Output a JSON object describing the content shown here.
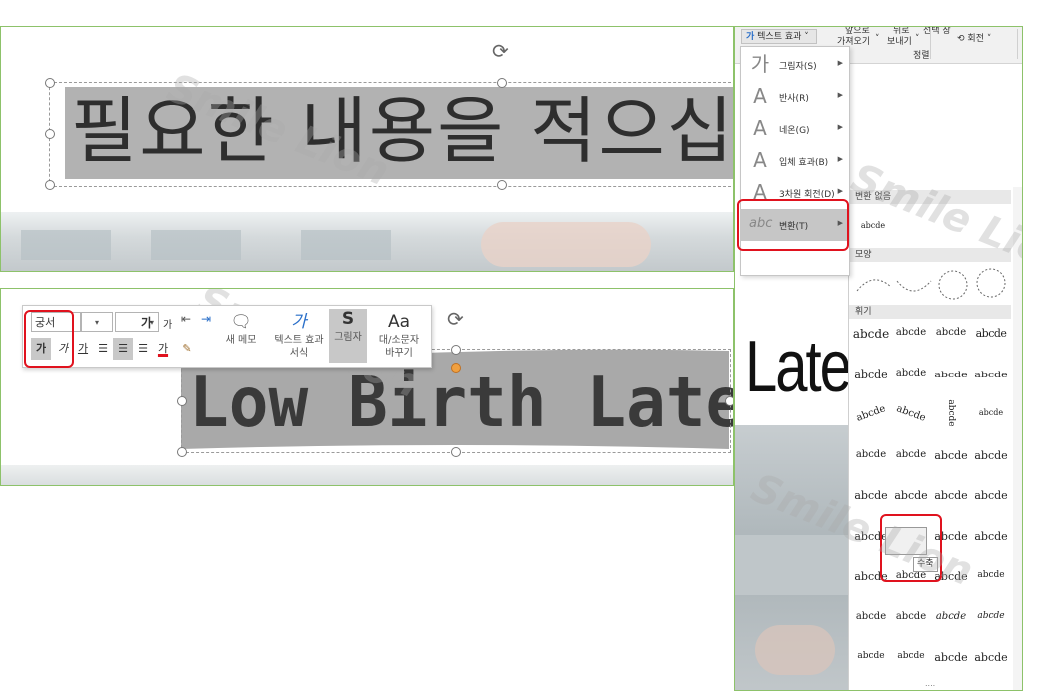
{
  "panel1": {
    "text": "필요한 내용을 적으십"
  },
  "panel2": {
    "text": "Low Birth Late",
    "toolbar": {
      "font_name": "궁서",
      "font_size": "",
      "grow_font_label": "가",
      "shrink_font_label": "가",
      "bold_label": "가",
      "italic_label": "가",
      "underline_label": "가",
      "font_color_label": "가",
      "new_memo_label": "새 메모",
      "text_effect_format_label": "텍스트 효과 서식",
      "shadow_label": "그림자",
      "shadow_glyph": "S",
      "change_case_label": "대/소문자 바꾸기",
      "change_case_glyph": "Aa",
      "text_effect_glyph": "가"
    }
  },
  "ribbon": {
    "text_effects_button": "텍스트 효과",
    "bring_forward": "가져오기",
    "send_backward": "보내기",
    "rotate": "회전",
    "arrange_group": "정렬",
    "top_partial_1": "앞으로",
    "top_partial_2": "뒤로",
    "top_partial_3": "선택 창"
  },
  "menu": {
    "items": [
      {
        "label": "그림자(S)",
        "glyph": "가"
      },
      {
        "label": "반사(R)",
        "glyph": "A"
      },
      {
        "label": "네온(G)",
        "glyph": "A"
      },
      {
        "label": "입체 효과(B)",
        "glyph": "A"
      },
      {
        "label": "3차원 회전(D)",
        "glyph": "A"
      },
      {
        "label": "변환(T)",
        "glyph": "abc"
      }
    ]
  },
  "submenu": {
    "no_transform_header": "변환 없음",
    "no_transform_sample": "abcde",
    "shape_header": "모양",
    "warp_header": "휘기",
    "samples": [
      "abcde",
      "abcde",
      "abcde",
      "abcde",
      "abcde",
      "abcde",
      "abcde",
      "abcde",
      "abcde",
      "abcde",
      "abcde",
      "abcde"
    ],
    "tooltip": "수축",
    "more": "...."
  },
  "background_large_text": "Late",
  "watermark": "Smile Lion"
}
